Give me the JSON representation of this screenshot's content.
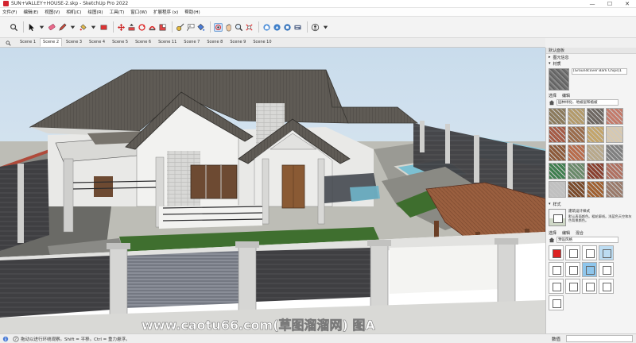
{
  "window": {
    "title": "SUN+VALLEY+HOUSE-2.skp - SketchUp Pro 2022",
    "controls": [
      "—",
      "☐",
      "✕"
    ]
  },
  "menu": [
    "文件(F)",
    "编辑(E)",
    "视图(V)",
    "相机(C)",
    "绘图(R)",
    "工具(T)",
    "窗口(W)",
    "扩展程序 (x)",
    "帮助(H)"
  ],
  "scenes": {
    "active_index": 1,
    "tabs": [
      "Scene 1",
      "Scene 2",
      "Scene 3",
      "Scene 4",
      "Scene 5",
      "Scene 6",
      "Scene 11",
      "Scene 7",
      "Scene 8",
      "Scene 9",
      "Scene 10"
    ]
  },
  "status": {
    "message": "拖动以进行环绕观察。Shift = 平移。Ctrl = 重力悬浮。",
    "measure_label": "数值",
    "watermark": "www.caotu66.com(草图溜溜网) 图A"
  },
  "tray": {
    "title": "默认面板",
    "entity_info": "图元信息",
    "materials": {
      "header": "材质",
      "current_name": "[Groundcover Bark Chips]1",
      "tabs": [
        "选择",
        "编辑"
      ],
      "library": "园林绿化、地被层和植被",
      "swatches": [
        "#8b7a5c",
        "#b39a6a",
        "#6d6660",
        "#c47a6a",
        "#a55a45",
        "#9a6b4a",
        "#c3a46a",
        "#d8c9b0",
        "#8d5a3a",
        "#b86b4a",
        "#b8a88a",
        "#7f7f7f",
        "#3f7f4f",
        "#6a8a6a",
        "#8a4030",
        "#b07060",
        "#c0c0c0",
        "#7a4a2a",
        "#a06030",
        "#9a7a6a"
      ]
    },
    "styles": {
      "header": "样式",
      "current_name": "建筑设计样式",
      "description": "默认表面颜色。粗轮廓线。浅蓝色天空和灰色背景颜色。",
      "tabs": [
        "选择",
        "编辑",
        "混合"
      ],
      "library": "预设风格"
    }
  }
}
